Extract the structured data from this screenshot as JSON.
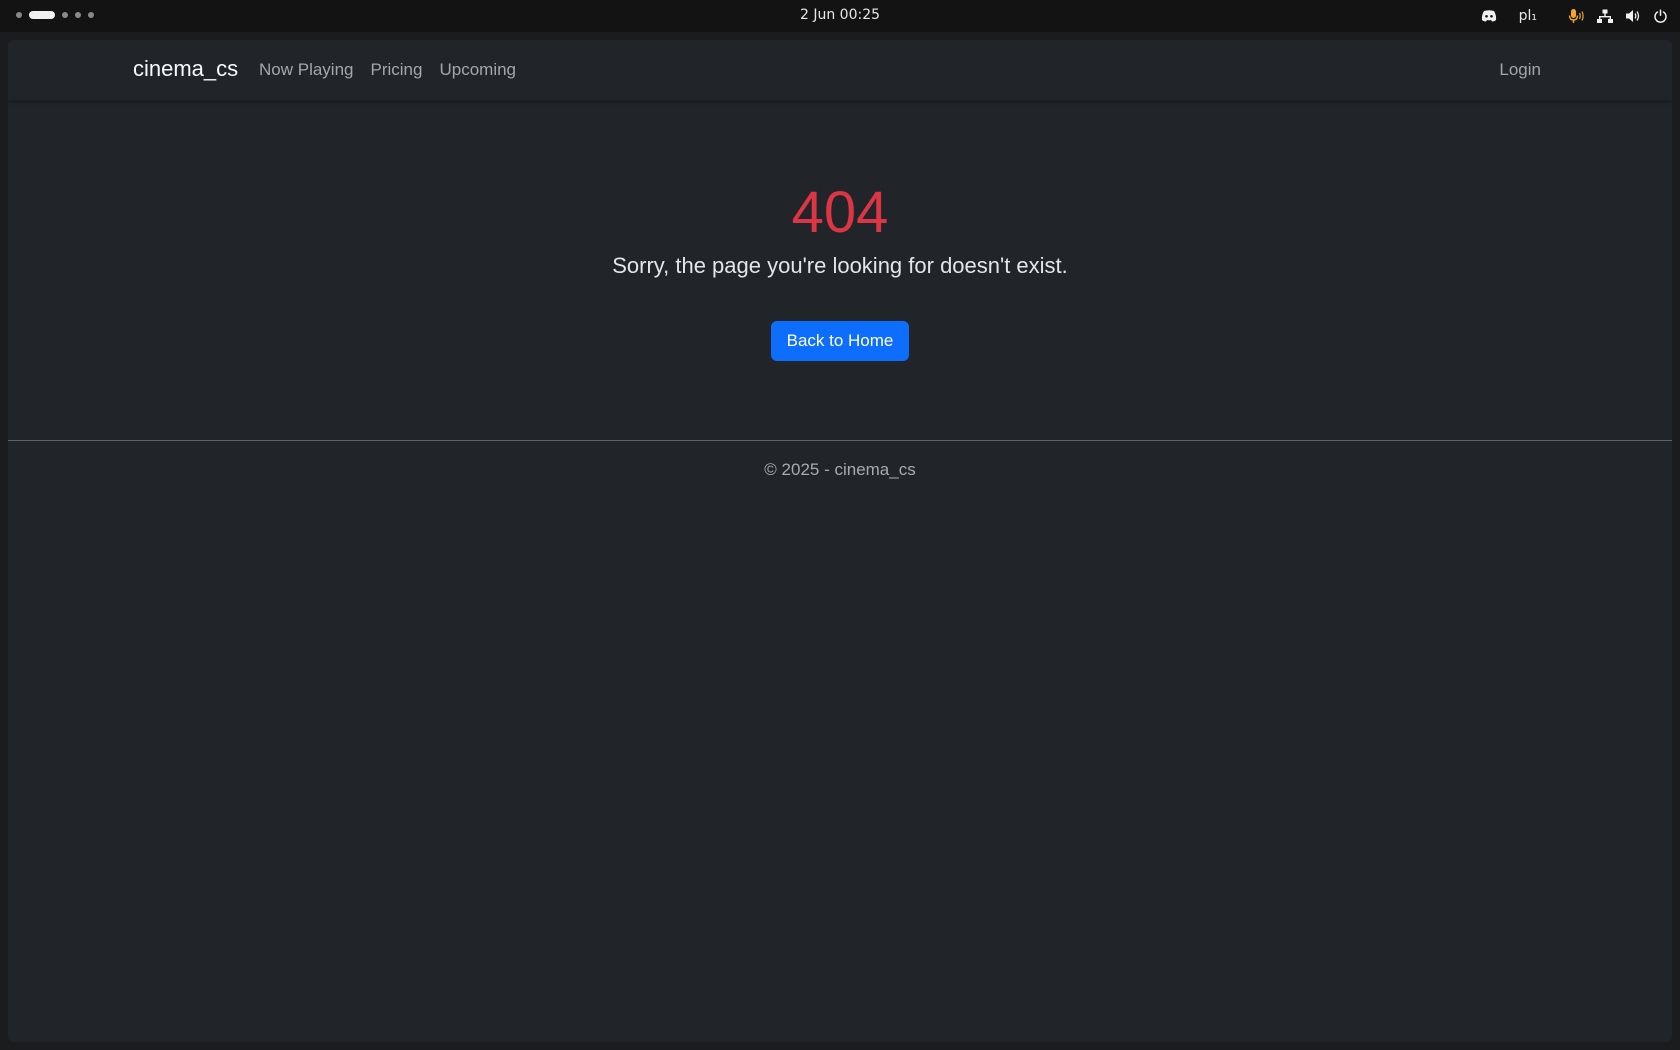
{
  "os": {
    "clock": "2 Jun  00:25",
    "language": "pl₁",
    "icons": [
      "discord-icon",
      "microphone-icon",
      "network-icon",
      "volume-icon",
      "power-icon"
    ],
    "accent_mic": "#f5a623"
  },
  "nav": {
    "brand": "cinema_cs",
    "links": [
      "Now Playing",
      "Pricing",
      "Upcoming"
    ],
    "login": "Login"
  },
  "error": {
    "code": "404",
    "message": "Sorry, the page you're looking for doesn't exist.",
    "button": "Back to Home",
    "code_color": "#dc3545",
    "button_color": "#0d6efd"
  },
  "footer": {
    "text": "© 2025 - cinema_cs"
  }
}
